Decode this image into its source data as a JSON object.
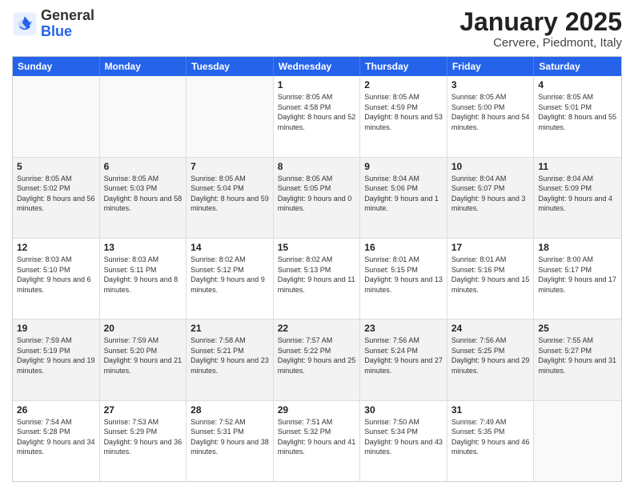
{
  "logo": {
    "general": "General",
    "blue": "Blue"
  },
  "header": {
    "title": "January 2025",
    "subtitle": "Cervere, Piedmont, Italy"
  },
  "days": [
    "Sunday",
    "Monday",
    "Tuesday",
    "Wednesday",
    "Thursday",
    "Friday",
    "Saturday"
  ],
  "weeks": [
    [
      {
        "day": "",
        "content": "",
        "empty": true
      },
      {
        "day": "",
        "content": "",
        "empty": true
      },
      {
        "day": "",
        "content": "",
        "empty": true
      },
      {
        "day": "1",
        "content": "Sunrise: 8:05 AM\nSunset: 4:58 PM\nDaylight: 8 hours and 52 minutes.",
        "empty": false
      },
      {
        "day": "2",
        "content": "Sunrise: 8:05 AM\nSunset: 4:59 PM\nDaylight: 8 hours and 53 minutes.",
        "empty": false
      },
      {
        "day": "3",
        "content": "Sunrise: 8:05 AM\nSunset: 5:00 PM\nDaylight: 8 hours and 54 minutes.",
        "empty": false
      },
      {
        "day": "4",
        "content": "Sunrise: 8:05 AM\nSunset: 5:01 PM\nDaylight: 8 hours and 55 minutes.",
        "empty": false
      }
    ],
    [
      {
        "day": "5",
        "content": "Sunrise: 8:05 AM\nSunset: 5:02 PM\nDaylight: 8 hours and 56 minutes.",
        "empty": false,
        "shaded": true
      },
      {
        "day": "6",
        "content": "Sunrise: 8:05 AM\nSunset: 5:03 PM\nDaylight: 8 hours and 58 minutes.",
        "empty": false,
        "shaded": true
      },
      {
        "day": "7",
        "content": "Sunrise: 8:05 AM\nSunset: 5:04 PM\nDaylight: 8 hours and 59 minutes.",
        "empty": false,
        "shaded": true
      },
      {
        "day": "8",
        "content": "Sunrise: 8:05 AM\nSunset: 5:05 PM\nDaylight: 9 hours and 0 minutes.",
        "empty": false,
        "shaded": true
      },
      {
        "day": "9",
        "content": "Sunrise: 8:04 AM\nSunset: 5:06 PM\nDaylight: 9 hours and 1 minute.",
        "empty": false,
        "shaded": true
      },
      {
        "day": "10",
        "content": "Sunrise: 8:04 AM\nSunset: 5:07 PM\nDaylight: 9 hours and 3 minutes.",
        "empty": false,
        "shaded": true
      },
      {
        "day": "11",
        "content": "Sunrise: 8:04 AM\nSunset: 5:09 PM\nDaylight: 9 hours and 4 minutes.",
        "empty": false,
        "shaded": true
      }
    ],
    [
      {
        "day": "12",
        "content": "Sunrise: 8:03 AM\nSunset: 5:10 PM\nDaylight: 9 hours and 6 minutes.",
        "empty": false
      },
      {
        "day": "13",
        "content": "Sunrise: 8:03 AM\nSunset: 5:11 PM\nDaylight: 9 hours and 8 minutes.",
        "empty": false
      },
      {
        "day": "14",
        "content": "Sunrise: 8:02 AM\nSunset: 5:12 PM\nDaylight: 9 hours and 9 minutes.",
        "empty": false
      },
      {
        "day": "15",
        "content": "Sunrise: 8:02 AM\nSunset: 5:13 PM\nDaylight: 9 hours and 11 minutes.",
        "empty": false
      },
      {
        "day": "16",
        "content": "Sunrise: 8:01 AM\nSunset: 5:15 PM\nDaylight: 9 hours and 13 minutes.",
        "empty": false
      },
      {
        "day": "17",
        "content": "Sunrise: 8:01 AM\nSunset: 5:16 PM\nDaylight: 9 hours and 15 minutes.",
        "empty": false
      },
      {
        "day": "18",
        "content": "Sunrise: 8:00 AM\nSunset: 5:17 PM\nDaylight: 9 hours and 17 minutes.",
        "empty": false
      }
    ],
    [
      {
        "day": "19",
        "content": "Sunrise: 7:59 AM\nSunset: 5:19 PM\nDaylight: 9 hours and 19 minutes.",
        "empty": false,
        "shaded": true
      },
      {
        "day": "20",
        "content": "Sunrise: 7:59 AM\nSunset: 5:20 PM\nDaylight: 9 hours and 21 minutes.",
        "empty": false,
        "shaded": true
      },
      {
        "day": "21",
        "content": "Sunrise: 7:58 AM\nSunset: 5:21 PM\nDaylight: 9 hours and 23 minutes.",
        "empty": false,
        "shaded": true
      },
      {
        "day": "22",
        "content": "Sunrise: 7:57 AM\nSunset: 5:22 PM\nDaylight: 9 hours and 25 minutes.",
        "empty": false,
        "shaded": true
      },
      {
        "day": "23",
        "content": "Sunrise: 7:56 AM\nSunset: 5:24 PM\nDaylight: 9 hours and 27 minutes.",
        "empty": false,
        "shaded": true
      },
      {
        "day": "24",
        "content": "Sunrise: 7:56 AM\nSunset: 5:25 PM\nDaylight: 9 hours and 29 minutes.",
        "empty": false,
        "shaded": true
      },
      {
        "day": "25",
        "content": "Sunrise: 7:55 AM\nSunset: 5:27 PM\nDaylight: 9 hours and 31 minutes.",
        "empty": false,
        "shaded": true
      }
    ],
    [
      {
        "day": "26",
        "content": "Sunrise: 7:54 AM\nSunset: 5:28 PM\nDaylight: 9 hours and 34 minutes.",
        "empty": false
      },
      {
        "day": "27",
        "content": "Sunrise: 7:53 AM\nSunset: 5:29 PM\nDaylight: 9 hours and 36 minutes.",
        "empty": false
      },
      {
        "day": "28",
        "content": "Sunrise: 7:52 AM\nSunset: 5:31 PM\nDaylight: 9 hours and 38 minutes.",
        "empty": false
      },
      {
        "day": "29",
        "content": "Sunrise: 7:51 AM\nSunset: 5:32 PM\nDaylight: 9 hours and 41 minutes.",
        "empty": false
      },
      {
        "day": "30",
        "content": "Sunrise: 7:50 AM\nSunset: 5:34 PM\nDaylight: 9 hours and 43 minutes.",
        "empty": false
      },
      {
        "day": "31",
        "content": "Sunrise: 7:49 AM\nSunset: 5:35 PM\nDaylight: 9 hours and 46 minutes.",
        "empty": false
      },
      {
        "day": "",
        "content": "",
        "empty": true
      }
    ]
  ]
}
